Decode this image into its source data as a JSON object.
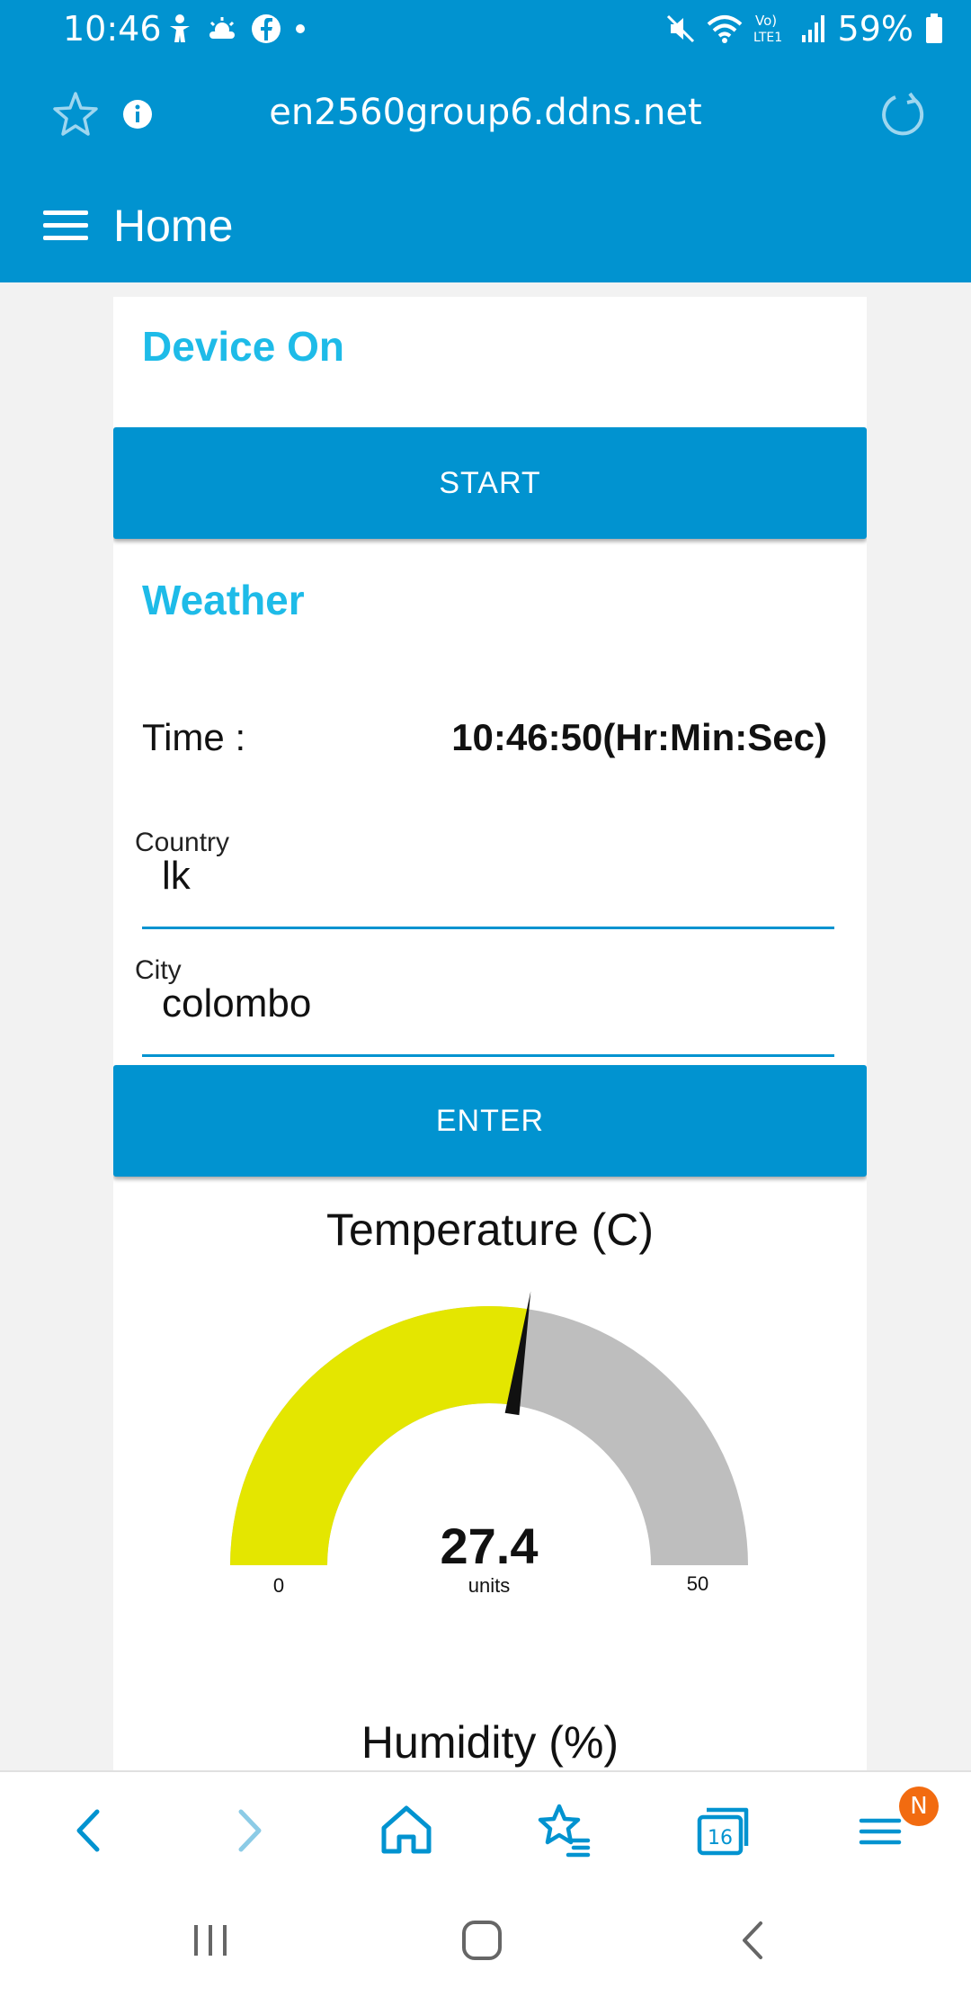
{
  "status_bar": {
    "time": "10:46",
    "battery": "59%",
    "icons": [
      "accessibility-icon",
      "weather-icon",
      "facebook-icon",
      "dot-icon",
      "mute-icon",
      "wifi-icon",
      "volte-icon",
      "signal-icon",
      "battery-icon"
    ]
  },
  "browser": {
    "url": "en2560group6.ddns.net",
    "tab_count": "16",
    "notification_badge": "N"
  },
  "app": {
    "title": "Home"
  },
  "device_section": {
    "title": "Device On",
    "button_label": "START"
  },
  "weather_section": {
    "title": "Weather",
    "time_label": "Time :",
    "time_value": "10:46:50(Hr:Min:Sec)",
    "country_label": "Country",
    "country_value": "lk",
    "city_label": "City",
    "city_value": "colombo",
    "enter_label": "ENTER"
  },
  "temperature_gauge": {
    "title": "Temperature (C)",
    "value": 27.4,
    "value_text": "27.4",
    "units": "units",
    "min": 0,
    "max": 50,
    "min_label": "0",
    "max_label": "50",
    "fill_color": "#e4e600",
    "track_color": "#bebebe",
    "needle_color": "#111111"
  },
  "humidity_gauge": {
    "title": "Humidity (%)"
  },
  "colors": {
    "primary": "#0193d0",
    "accent_title": "#1ebbe8",
    "badge": "#f26b10"
  }
}
